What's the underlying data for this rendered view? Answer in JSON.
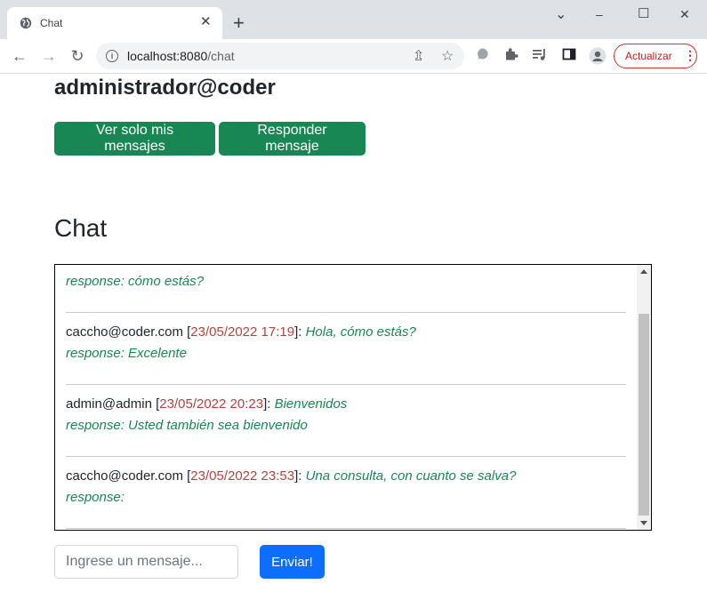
{
  "browser": {
    "tab_title": "Chat",
    "tab_close": "✕",
    "new_tab": "+",
    "url_host": "localhost:8080",
    "url_path": "/chat",
    "update_label": "Actualizar",
    "update_dots": "⋮",
    "window_controls": {
      "minimize": "–",
      "maximize": "☐",
      "close": "✕",
      "dropdown": "⌄"
    }
  },
  "page": {
    "user_email": "administrador@coder",
    "actions": [
      {
        "label": "Ver solo mis mensajes"
      },
      {
        "label": "Responder mensaje"
      }
    ],
    "chat_title": "Chat",
    "messages": [
      {
        "author": "",
        "date": "",
        "text": "",
        "response": "response: cómo estás?"
      },
      {
        "author": "caccho@coder.com",
        "date": "23/05/2022 17:19",
        "text": "Hola, cómo estás?",
        "response": "response: Excelente"
      },
      {
        "author": "admin@admin",
        "date": "23/05/2022 20:23",
        "text": "Bienvenidos",
        "response": "response: Usted también sea bienvenido"
      },
      {
        "author": "caccho@coder.com",
        "date": "23/05/2022 23:53",
        "text": "Una consulta, con cuanto se salva?",
        "response": "response:"
      }
    ],
    "input_placeholder": "Ingrese un mensaje...",
    "send_label": "Enviar!"
  },
  "colors": {
    "success": "#198754",
    "primary": "#0d6efd",
    "date": "#b1443d",
    "update_accent": "#d93025"
  }
}
